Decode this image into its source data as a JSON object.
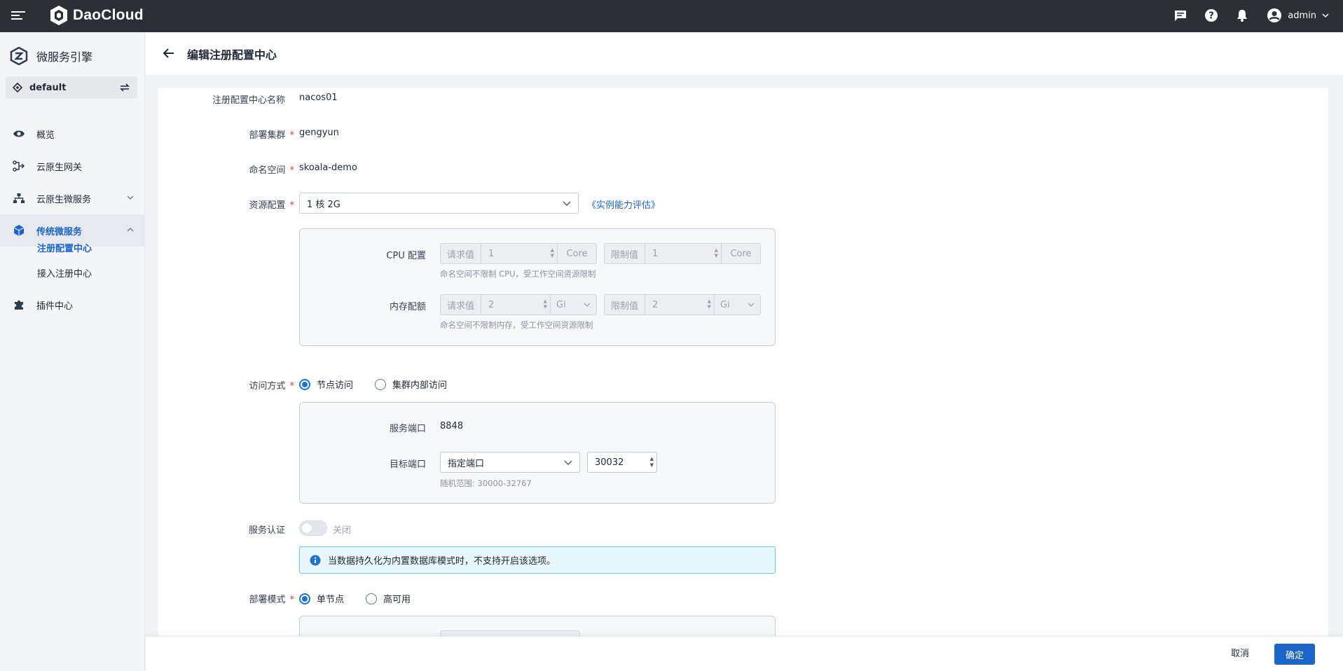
{
  "topbar": {
    "brand": "DaoCloud",
    "user": "admin"
  },
  "sidebar": {
    "title": "微服务引擎",
    "namespace": "default",
    "items": [
      {
        "label": "概览"
      },
      {
        "label": "云原生网关"
      },
      {
        "label": "云原生微服务"
      },
      {
        "label": "传统微服务"
      },
      {
        "label": "插件中心"
      }
    ],
    "subitems": [
      {
        "label": "注册配置中心"
      },
      {
        "label": "接入注册中心"
      }
    ]
  },
  "header": {
    "title": "编辑注册配置中心"
  },
  "form": {
    "name": {
      "label": "注册配置中心名称",
      "value": "nacos01"
    },
    "cluster": {
      "label": "部署集群",
      "required": "*",
      "value": "gengyun"
    },
    "namespace": {
      "label": "命名空间",
      "required": "*",
      "value": "skoala-demo"
    },
    "resource": {
      "label": "资源配置",
      "required": "*",
      "value": "1 核 2G",
      "link": "《实例能力评估》"
    },
    "cpu": {
      "label": "CPU 配置",
      "request_prefix": "请求值",
      "request_value": "1",
      "request_unit": "Core",
      "limit_prefix": "限制值",
      "limit_value": "1",
      "limit_unit": "Core",
      "hint": "命名空间不限制 CPU，受工作空间资源限制"
    },
    "memory": {
      "label": "内存配额",
      "request_prefix": "请求值",
      "request_value": "2",
      "request_unit": "Gi",
      "limit_prefix": "限制值",
      "limit_value": "2",
      "limit_unit": "Gi",
      "hint": "命名空间不限制内存，受工作空间资源限制"
    },
    "access": {
      "label": "访问方式",
      "required": "*",
      "option1": "节点访问",
      "option2": "集群内部访问"
    },
    "service_port": {
      "label": "服务端口",
      "value": "8848"
    },
    "target_port": {
      "label": "目标端口",
      "mode": "指定端口",
      "value": "30032",
      "hint": "随机范围: 30000-32767"
    },
    "auth": {
      "label": "服务认证",
      "state": "关闭"
    },
    "alert": "当数据持久化为内置数据库模式时，不支持开启该选项。",
    "deploy": {
      "label": "部署模式",
      "required": "*",
      "option1": "单节点",
      "option2": "高可用"
    }
  },
  "footer": {
    "cancel": "取消",
    "ok": "确定"
  }
}
